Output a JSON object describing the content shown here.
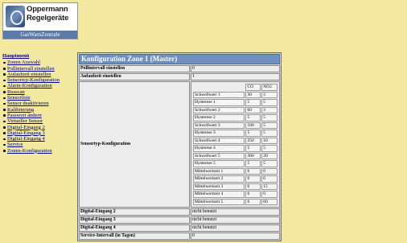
{
  "logo": {
    "line1": "Oppermann",
    "line2": "Regelgeräte",
    "subtitle": "GasWarnZentrale"
  },
  "nav": {
    "title": "Hauptmenü",
    "items": [
      "Zonen Auswahl",
      "Pollintervall einstellen",
      "Aufaufzeit einstellen",
      "Sensortyp-Konfiguration",
      "Alarm-Konfiguration",
      "Busscan",
      "Sensorliste",
      "Sensor deaktivieren",
      "Kalibrierung",
      "Passwort ändern",
      "Virtueller Sensor",
      "Digital-Eingang 2",
      "Digital-Eingang 3",
      "Digital-Eingang 4",
      "Service",
      "Zonen-Konfiguration"
    ]
  },
  "config": {
    "title": "Konfiguration Zone 1 (Master)",
    "rows_top": [
      {
        "label": "Pollintervall einstellen",
        "value": "0"
      },
      {
        "label": "Aufaufzeit einstellen",
        "value": "1"
      }
    ],
    "sensor_label": "Sensortyp-Konfiguration",
    "columns": [
      "CO",
      "NO2"
    ],
    "sensor_rows": [
      {
        "label": "Schwellwert 1",
        "co": "30",
        "no2": "2"
      },
      {
        "label": "Hysterese 1",
        "co": "5",
        "no2": "5"
      },
      {
        "label": "Schwellwert 2",
        "co": "60",
        "no2": "3"
      },
      {
        "label": "Hysterese 2",
        "co": "5",
        "no2": "5"
      },
      {
        "label": "Schwellwert 3",
        "co": "100",
        "no2": "5"
      },
      {
        "label": "Hysterese 3",
        "co": "5",
        "no2": "5"
      },
      {
        "label": "Schwellwert 4",
        "co": "250",
        "no2": "10"
      },
      {
        "label": "Hysterese 4",
        "co": "5",
        "no2": "5"
      },
      {
        "label": "Schwellwert 5",
        "co": "360",
        "no2": "20"
      },
      {
        "label": "Hysterese 5",
        "co": "5",
        "no2": "5"
      },
      {
        "label": "Mittelwertzeit 1",
        "co": "0",
        "no2": "0"
      },
      {
        "label": "Mittelwertzeit 2",
        "co": "0",
        "no2": "0"
      },
      {
        "label": "Mittelwertzeit 3",
        "co": "0",
        "no2": "15"
      },
      {
        "label": "Mittelwertzeit 4",
        "co": "0",
        "no2": "0"
      },
      {
        "label": "Mittelwertzeit 5",
        "co": "0",
        "no2": "60"
      }
    ],
    "rows_bottom": [
      {
        "label": "Digital-Eingang 2",
        "value": "nicht benutzt"
      },
      {
        "label": "Digital-Eingang 3",
        "value": "nicht benutzt"
      },
      {
        "label": "Digital-Eingang 4",
        "value": "nicht benutzt"
      },
      {
        "label": "Service-Intervall (in Tagen)",
        "value": "0"
      }
    ]
  }
}
